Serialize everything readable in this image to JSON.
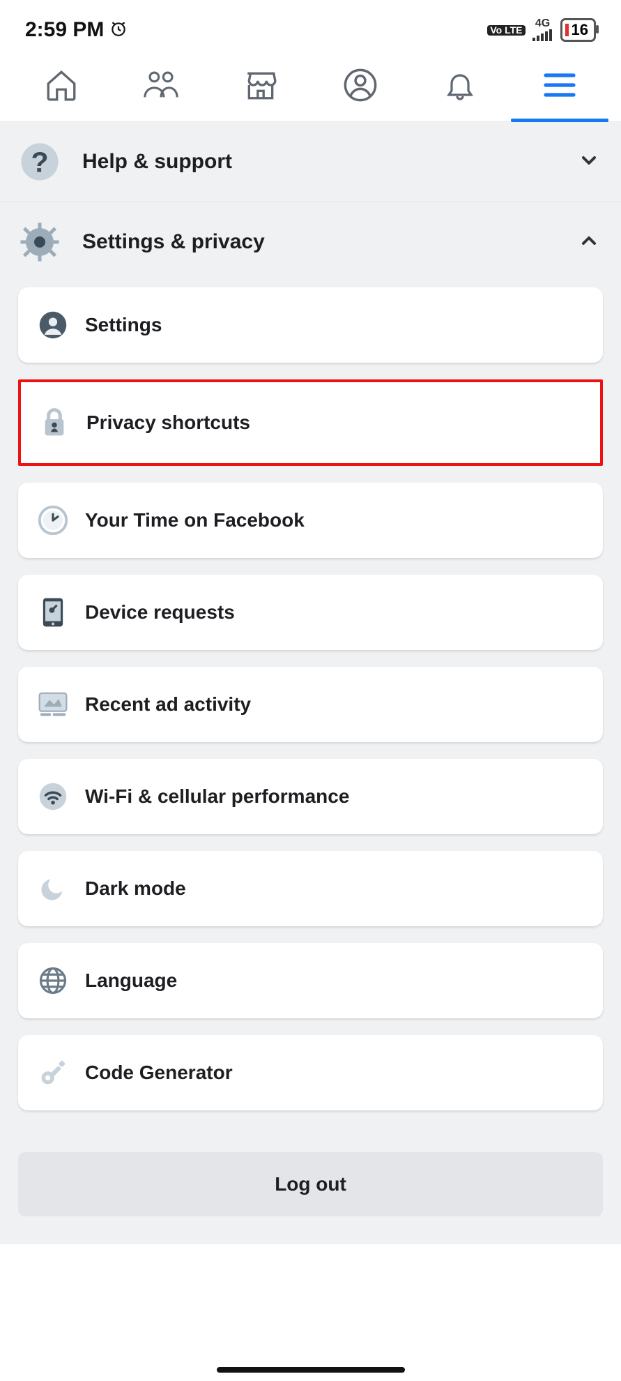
{
  "status": {
    "time": "2:59 PM",
    "network_badge": "Vo\nLTE",
    "network_type": "4G",
    "battery_percent": "16"
  },
  "tabs": {
    "home": "Home",
    "friends": "Friends",
    "marketplace": "Marketplace",
    "profile": "Profile",
    "notifications": "Notifications",
    "menu": "Menu"
  },
  "sections": {
    "help": {
      "title": "Help & support"
    },
    "settings": {
      "title": "Settings & privacy"
    }
  },
  "settings_items": [
    {
      "label": "Settings"
    },
    {
      "label": "Privacy shortcuts",
      "highlight": true
    },
    {
      "label": "Your Time on Facebook"
    },
    {
      "label": "Device requests"
    },
    {
      "label": "Recent ad activity"
    },
    {
      "label": "Wi-Fi & cellular performance"
    },
    {
      "label": "Dark mode"
    },
    {
      "label": "Language"
    },
    {
      "label": "Code Generator"
    }
  ],
  "logout": {
    "label": "Log out"
  }
}
